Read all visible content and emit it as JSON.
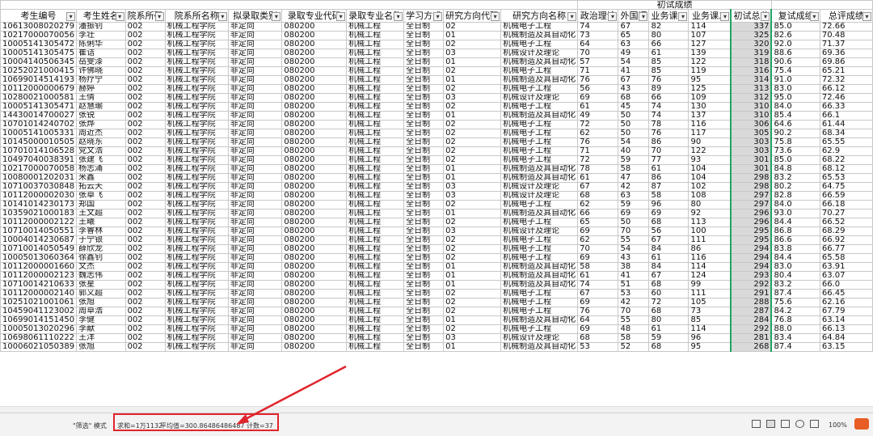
{
  "header": {
    "group_title": "初试成绩",
    "columns": [
      "考生编号",
      "考生姓名",
      "院系所码",
      "院系所名称",
      "拟录取类别",
      "录取专业代码",
      "录取专业名称",
      "学习方式",
      "研究方向代码",
      "研究方向名称",
      "政治理论",
      "外国语",
      "业务课一",
      "业务课二",
      "初试总分",
      "复试成绩",
      "总评成绩"
    ]
  },
  "rows": [
    [
      "10613008020279",
      "潘振钊",
      "002",
      "机械工程学院",
      "非定向",
      "080200",
      "机械工程",
      "全日制",
      "02",
      "机械电子工程",
      "74",
      "67",
      "82",
      "114",
      "337",
      "85.0",
      "72.66"
    ],
    [
      "10217000070056",
      "李壮",
      "002",
      "机械工程学院",
      "非定向",
      "080200",
      "机械工程",
      "全日制",
      "01",
      "机械制造及其自动化",
      "73",
      "65",
      "80",
      "107",
      "325",
      "82.6",
      "70.48"
    ],
    [
      "10005141305472",
      "陈俐华",
      "002",
      "机械工程学院",
      "非定向",
      "080200",
      "机械工程",
      "全日制",
      "02",
      "机械电子工程",
      "64",
      "63",
      "66",
      "127",
      "320",
      "92.0",
      "71.37"
    ],
    [
      "10005141305475",
      "崔诘",
      "002",
      "机械工程学院",
      "非定向",
      "080200",
      "机械工程",
      "全日制",
      "03",
      "机械设计及理论",
      "70",
      "49",
      "61",
      "139",
      "319",
      "88.6",
      "69.36"
    ],
    [
      "10004140506345",
      "岳雯漆",
      "002",
      "机械工程学院",
      "非定向",
      "080200",
      "机械工程",
      "全日制",
      "01",
      "机械制造及其自动化",
      "57",
      "54",
      "85",
      "122",
      "318",
      "90.6",
      "69.86"
    ],
    [
      "10252021000415",
      "许佛晓",
      "002",
      "机械工程学院",
      "非定向",
      "080200",
      "机械工程",
      "全日制",
      "02",
      "机械电子工程",
      "71",
      "41",
      "85",
      "119",
      "316",
      "75.4",
      "65.21"
    ],
    [
      "10699014514193",
      "杨疗宁",
      "002",
      "机械工程学院",
      "非定向",
      "080200",
      "机械工程",
      "全日制",
      "01",
      "机械制造及其自动化",
      "76",
      "67",
      "76",
      "95",
      "314",
      "91.0",
      "72.32"
    ],
    [
      "10112000000679",
      "赫婷",
      "002",
      "机械工程学院",
      "非定向",
      "080200",
      "机械工程",
      "全日制",
      "02",
      "机械电子工程",
      "56",
      "43",
      "89",
      "125",
      "313",
      "83.0",
      "66.12"
    ],
    [
      "10280021000581",
      "王倩",
      "002",
      "机械工程学院",
      "非定向",
      "080200",
      "机械工程",
      "全日制",
      "03",
      "机械设计及理论",
      "69",
      "68",
      "66",
      "109",
      "312",
      "95.0",
      "72.46"
    ],
    [
      "10005141305471",
      "赵慧瑜",
      "002",
      "机械工程学院",
      "非定向",
      "080200",
      "机械工程",
      "全日制",
      "02",
      "机械电子工程",
      "61",
      "45",
      "74",
      "130",
      "310",
      "84.0",
      "66.33"
    ],
    [
      "14430014700027",
      "张锐",
      "002",
      "机械工程学院",
      "非定向",
      "080200",
      "机械工程",
      "全日制",
      "01",
      "机械制造及其自动化",
      "49",
      "50",
      "74",
      "137",
      "310",
      "85.4",
      "66.1"
    ],
    [
      "10701014240702",
      "张烨",
      "002",
      "机械工程学院",
      "非定向",
      "080200",
      "机械工程",
      "全日制",
      "02",
      "机械电子工程",
      "72",
      "50",
      "78",
      "116",
      "306",
      "64.6",
      "61.44"
    ],
    [
      "10005141005331",
      "周近杰",
      "002",
      "机械工程学院",
      "非定向",
      "080200",
      "机械工程",
      "全日制",
      "02",
      "机械电子工程",
      "62",
      "50",
      "76",
      "117",
      "305",
      "90.2",
      "68.34"
    ],
    [
      "10145000010505",
      "赵晓东",
      "002",
      "机械工程学院",
      "非定向",
      "080200",
      "机械工程",
      "全日制",
      "02",
      "机械电子工程",
      "76",
      "54",
      "86",
      "90",
      "303",
      "75.8",
      "65.55"
    ],
    [
      "10701014106528",
      "党文浩",
      "002",
      "机械工程学院",
      "非定向",
      "080200",
      "机械工程",
      "全日制",
      "02",
      "机械电子工程",
      "71",
      "40",
      "70",
      "122",
      "303",
      "73.6",
      "62.9"
    ],
    [
      "10497040038391",
      "张建飞",
      "002",
      "机械工程学院",
      "非定向",
      "080200",
      "机械工程",
      "全日制",
      "02",
      "机械电子工程",
      "72",
      "59",
      "77",
      "93",
      "301",
      "85.0",
      "68.22"
    ],
    [
      "10217000070058",
      "杨志涌",
      "002",
      "机械工程学院",
      "非定向",
      "080200",
      "机械工程",
      "全日制",
      "01",
      "机械制造及其自动化",
      "78",
      "58",
      "61",
      "104",
      "301",
      "84.8",
      "68.12"
    ],
    [
      "10080001202031",
      "米鑫",
      "002",
      "机械工程学院",
      "非定向",
      "080200",
      "机械工程",
      "全日制",
      "01",
      "机械制造及其自动化",
      "61",
      "47",
      "86",
      "104",
      "298",
      "83.2",
      "65.53"
    ],
    [
      "10710037030848",
      "拓云天",
      "002",
      "机械工程学院",
      "非定向",
      "080200",
      "机械工程",
      "全日制",
      "03",
      "机械设计及理论",
      "67",
      "42",
      "87",
      "102",
      "298",
      "80.2",
      "64.75"
    ],
    [
      "10112000002030",
      "张卓飞",
      "002",
      "机械工程学院",
      "非定向",
      "080200",
      "机械工程",
      "全日制",
      "03",
      "机械设计及理论",
      "68",
      "63",
      "58",
      "108",
      "297",
      "82.8",
      "66.59"
    ],
    [
      "10141014230173",
      "郑国",
      "002",
      "机械工程学院",
      "非定向",
      "080200",
      "机械工程",
      "全日制",
      "02",
      "机械电子工程",
      "62",
      "59",
      "96",
      "80",
      "297",
      "84.0",
      "66.18"
    ],
    [
      "10359021000183",
      "王文超",
      "002",
      "机械工程学院",
      "非定向",
      "080200",
      "机械工程",
      "全日制",
      "01",
      "机械制造及其自动化",
      "66",
      "69",
      "69",
      "92",
      "296",
      "93.0",
      "70.27"
    ],
    [
      "10112000002122",
      "王曦",
      "002",
      "机械工程学院",
      "非定向",
      "080200",
      "机械工程",
      "全日制",
      "02",
      "机械电子工程",
      "65",
      "50",
      "68",
      "113",
      "296",
      "84.4",
      "66.52"
    ],
    [
      "10710014050551",
      "李睿林",
      "002",
      "机械工程学院",
      "非定向",
      "080200",
      "机械工程",
      "全日制",
      "03",
      "机械设计及理论",
      "69",
      "70",
      "56",
      "100",
      "295",
      "86.8",
      "68.29"
    ],
    [
      "10004014230687",
      "于宁银",
      "002",
      "机械工程学院",
      "非定向",
      "080200",
      "机械工程",
      "全日制",
      "02",
      "机械电子工程",
      "62",
      "55",
      "67",
      "111",
      "295",
      "86.6",
      "66.92"
    ],
    [
      "10710014050549",
      "薛欣龙",
      "002",
      "机械工程学院",
      "非定向",
      "080200",
      "机械工程",
      "全日制",
      "02",
      "机械电子工程",
      "70",
      "54",
      "84",
      "86",
      "294",
      "83.8",
      "66.77"
    ],
    [
      "10005013060364",
      "徐鑫钊",
      "002",
      "机械工程学院",
      "非定向",
      "080200",
      "机械工程",
      "全日制",
      "02",
      "机械电子工程",
      "69",
      "43",
      "61",
      "116",
      "294",
      "84.4",
      "65.58"
    ],
    [
      "10112000001660",
      "文杰",
      "002",
      "机械工程学院",
      "非定向",
      "080200",
      "机械工程",
      "全日制",
      "01",
      "机械制造及其自动化",
      "58",
      "38",
      "84",
      "114",
      "294",
      "83.0",
      "63.91"
    ],
    [
      "10112000002123",
      "魏志伟",
      "002",
      "机械工程学院",
      "非定向",
      "080200",
      "机械工程",
      "全日制",
      "01",
      "机械制造及其自动化",
      "61",
      "41",
      "67",
      "124",
      "293",
      "80.4",
      "63.07"
    ],
    [
      "10710014210633",
      "张星",
      "002",
      "机械工程学院",
      "非定向",
      "080200",
      "机械工程",
      "全日制",
      "01",
      "机械制造及其自动化",
      "74",
      "51",
      "68",
      "99",
      "292",
      "83.2",
      "66.0"
    ],
    [
      "10112000002140",
      "郭义超",
      "002",
      "机械工程学院",
      "非定向",
      "080200",
      "机械工程",
      "全日制",
      "02",
      "机械电子工程",
      "67",
      "53",
      "60",
      "111",
      "291",
      "87.4",
      "66.45"
    ],
    [
      "10251021001061",
      "张旭",
      "002",
      "机械工程学院",
      "非定向",
      "080200",
      "机械工程",
      "全日制",
      "02",
      "机械电子工程",
      "69",
      "42",
      "72",
      "105",
      "288",
      "75.6",
      "62.16"
    ],
    [
      "10459041123002",
      "周卓浩",
      "002",
      "机械工程学院",
      "非定向",
      "080200",
      "机械工程",
      "全日制",
      "02",
      "机械电子工程",
      "76",
      "70",
      "68",
      "73",
      "287",
      "84.2",
      "67.79"
    ],
    [
      "10699014151450",
      "李健",
      "002",
      "机械工程学院",
      "非定向",
      "080200",
      "机械工程",
      "全日制",
      "01",
      "机械制造及其自动化",
      "64",
      "55",
      "80",
      "85",
      "284",
      "76.8",
      "63.14"
    ],
    [
      "10005013020296",
      "李献",
      "002",
      "机械工程学院",
      "非定向",
      "080200",
      "机械工程",
      "全日制",
      "02",
      "机械电子工程",
      "69",
      "48",
      "61",
      "114",
      "292",
      "88.0",
      "66.13"
    ],
    [
      "10698061110222",
      "王洋",
      "002",
      "机械工程学院",
      "非定向",
      "080200",
      "机械工程",
      "全日制",
      "03",
      "机械设计及理论",
      "68",
      "58",
      "59",
      "96",
      "281",
      "83.4",
      "64.84"
    ],
    [
      "10006021050389",
      "张旭",
      "002",
      "机械工程学院",
      "非定向",
      "080200",
      "机械工程",
      "全日制",
      "01",
      "机械制造及其自动化",
      "53",
      "52",
      "68",
      "95",
      "268",
      "87.4",
      "63.15"
    ]
  ],
  "statusbar": {
    "mode": "\"筛选\" 模式",
    "sum": "求和=1万1132",
    "average": "平均值=300.86486486487",
    "count": "计数=37",
    "zoom": "100%"
  },
  "colors": {
    "highlight": "#e0242c",
    "selection": "#21a366",
    "sum_fill": "#d9d9d9"
  }
}
